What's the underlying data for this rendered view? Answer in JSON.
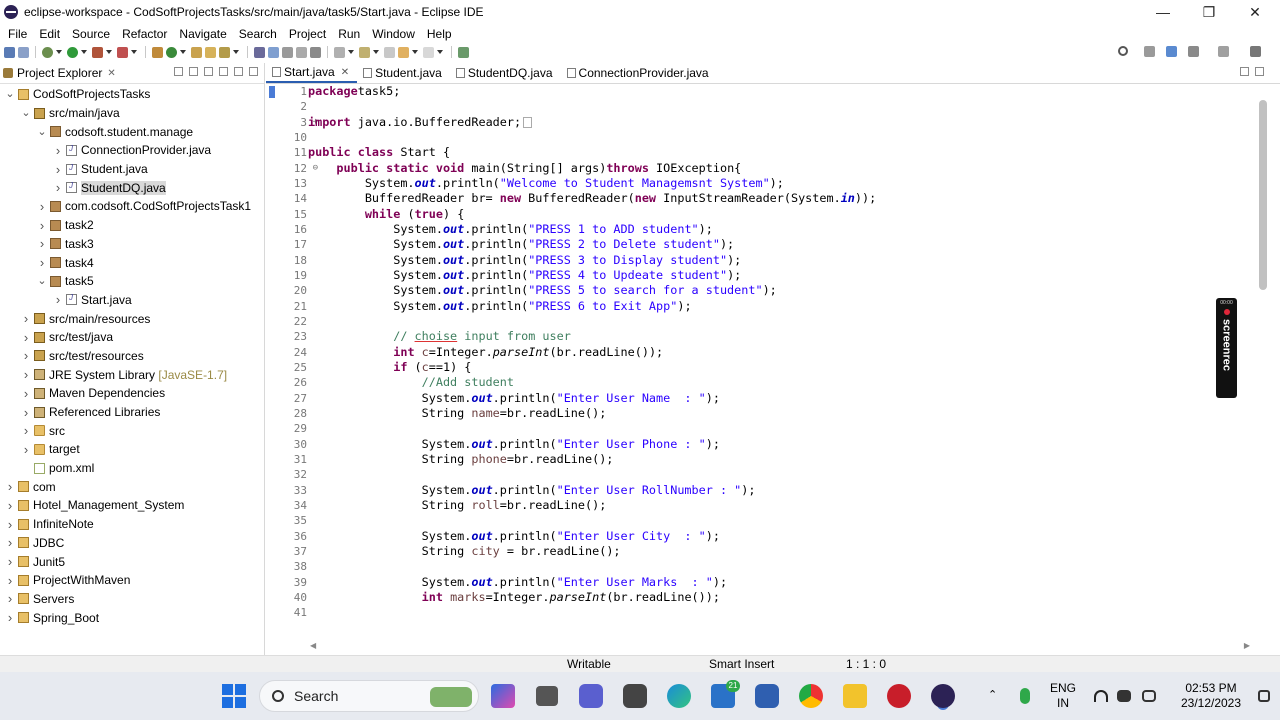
{
  "window": {
    "title": "eclipse-workspace - CodSoftProjectsTasks/src/main/java/task5/Start.java - Eclipse IDE",
    "minimize_icon": "minimize-icon",
    "restore_icon": "restore-icon",
    "close_icon": "close-icon"
  },
  "menu": [
    "File",
    "Edit",
    "Source",
    "Refactor",
    "Navigate",
    "Search",
    "Project",
    "Run",
    "Window",
    "Help"
  ],
  "left_pane": {
    "tab_label": "Project Explorer",
    "tree": [
      {
        "label": "CodSoftProjectsTasks",
        "depth": 0,
        "twisty": "v",
        "icon": "project"
      },
      {
        "label": "src/main/java",
        "depth": 1,
        "twisty": "v",
        "icon": "srcfolder"
      },
      {
        "label": "codsoft.student.manage",
        "depth": 2,
        "twisty": "v",
        "icon": "package"
      },
      {
        "label": "ConnectionProvider.java",
        "depth": 3,
        "twisty": ">",
        "icon": "java"
      },
      {
        "label": "Student.java",
        "depth": 3,
        "twisty": ">",
        "icon": "java"
      },
      {
        "label": "StudentDQ.java",
        "depth": 3,
        "twisty": ">",
        "icon": "java",
        "selected": true
      },
      {
        "label": "com.codsoft.CodSoftProjectsTask1",
        "depth": 2,
        "twisty": ">",
        "icon": "package"
      },
      {
        "label": "task2",
        "depth": 2,
        "twisty": ">",
        "icon": "package"
      },
      {
        "label": "task3",
        "depth": 2,
        "twisty": ">",
        "icon": "package"
      },
      {
        "label": "task4",
        "depth": 2,
        "twisty": ">",
        "icon": "package"
      },
      {
        "label": "task5",
        "depth": 2,
        "twisty": "v",
        "icon": "package"
      },
      {
        "label": "Start.java",
        "depth": 3,
        "twisty": ">",
        "icon": "java"
      },
      {
        "label": "src/main/resources",
        "depth": 1,
        "twisty": ">",
        "icon": "srcfolder"
      },
      {
        "label": "src/test/java",
        "depth": 1,
        "twisty": ">",
        "icon": "srcfolder"
      },
      {
        "label": "src/test/resources",
        "depth": 1,
        "twisty": ">",
        "icon": "srcfolder"
      },
      {
        "label": "JRE System Library",
        "suffix": "[JavaSE-1.7]",
        "depth": 1,
        "twisty": ">",
        "icon": "lib"
      },
      {
        "label": "Maven Dependencies",
        "depth": 1,
        "twisty": ">",
        "icon": "lib"
      },
      {
        "label": "Referenced Libraries",
        "depth": 1,
        "twisty": ">",
        "icon": "lib"
      },
      {
        "label": "src",
        "depth": 1,
        "twisty": ">",
        "icon": "folder"
      },
      {
        "label": "target",
        "depth": 1,
        "twisty": ">",
        "icon": "folder"
      },
      {
        "label": "pom.xml",
        "depth": 1,
        "twisty": "",
        "icon": "xml"
      },
      {
        "label": "com",
        "depth": 0,
        "twisty": ">",
        "icon": "project"
      },
      {
        "label": "Hotel_Management_System",
        "depth": 0,
        "twisty": ">",
        "icon": "project"
      },
      {
        "label": "InfiniteNote",
        "depth": 0,
        "twisty": ">",
        "icon": "project"
      },
      {
        "label": "JDBC",
        "depth": 0,
        "twisty": ">",
        "icon": "project"
      },
      {
        "label": "Junit5",
        "depth": 0,
        "twisty": ">",
        "icon": "project"
      },
      {
        "label": "ProjectWithMaven",
        "depth": 0,
        "twisty": ">",
        "icon": "project"
      },
      {
        "label": "Servers",
        "depth": 0,
        "twisty": ">",
        "icon": "project"
      },
      {
        "label": "Spring_Boot",
        "depth": 0,
        "twisty": ">",
        "icon": "project"
      }
    ]
  },
  "editor_tabs": [
    {
      "label": "Start.java",
      "active": true
    },
    {
      "label": "Student.java",
      "active": false
    },
    {
      "label": "StudentDQ.java",
      "active": false
    },
    {
      "label": "ConnectionProvider.java",
      "active": false
    }
  ],
  "editor": {
    "lines": [
      {
        "no": "1",
        "fold": "",
        "tokens": [
          [
            "kw",
            "package"
          ],
          [
            "",
            "task5;"
          ]
        ]
      },
      {
        "no": "2",
        "fold": "",
        "tokens": []
      },
      {
        "no": "3",
        "fold": "+",
        "tokens": [
          [
            "kw",
            "import"
          ],
          [
            "",
            " java.io.BufferedReader;"
          ],
          [
            "box",
            "□"
          ]
        ]
      },
      {
        "no": "10",
        "fold": "",
        "tokens": []
      },
      {
        "no": "11",
        "fold": "",
        "tokens": [
          [
            "kw",
            "public class"
          ],
          [
            "",
            " Start {"
          ]
        ]
      },
      {
        "no": "12",
        "fold": "-",
        "tokens": [
          [
            "",
            "    "
          ],
          [
            "kw",
            "public static void"
          ],
          [
            "",
            " main(String[] args)"
          ],
          [
            "kw",
            "throws"
          ],
          [
            "",
            " IOException{"
          ]
        ]
      },
      {
        "no": "13",
        "fold": "",
        "tokens": [
          [
            "",
            "        System."
          ],
          [
            "fld",
            "out"
          ],
          [
            "",
            ".println("
          ],
          [
            "str",
            "\"Welcome to Student Managemsnt System\""
          ],
          [
            "",
            ");"
          ]
        ]
      },
      {
        "no": "14",
        "fold": "",
        "tokens": [
          [
            "",
            "        BufferedReader br= "
          ],
          [
            "kw",
            "new"
          ],
          [
            "",
            " BufferedReader("
          ],
          [
            "kw",
            "new"
          ],
          [
            "",
            " InputStreamReader(System."
          ],
          [
            "fld",
            "in"
          ],
          [
            "",
            "));"
          ]
        ]
      },
      {
        "no": "15",
        "fold": "",
        "tokens": [
          [
            "",
            "        "
          ],
          [
            "kw",
            "while"
          ],
          [
            "",
            " ("
          ],
          [
            "kw",
            "true"
          ],
          [
            "",
            ") {"
          ]
        ]
      },
      {
        "no": "16",
        "fold": "",
        "tokens": [
          [
            "",
            "            System."
          ],
          [
            "fld",
            "out"
          ],
          [
            "",
            ".println("
          ],
          [
            "str",
            "\"PRESS 1 to ADD student\""
          ],
          [
            "",
            ");"
          ]
        ]
      },
      {
        "no": "17",
        "fold": "",
        "tokens": [
          [
            "",
            "            System."
          ],
          [
            "fld",
            "out"
          ],
          [
            "",
            ".println("
          ],
          [
            "str",
            "\"PRESS 2 to Delete student\""
          ],
          [
            "",
            ");"
          ]
        ]
      },
      {
        "no": "18",
        "fold": "",
        "tokens": [
          [
            "",
            "            System."
          ],
          [
            "fld",
            "out"
          ],
          [
            "",
            ".println("
          ],
          [
            "str",
            "\"PRESS 3 to Display student\""
          ],
          [
            "",
            ");"
          ]
        ]
      },
      {
        "no": "19",
        "fold": "",
        "tokens": [
          [
            "",
            "            System."
          ],
          [
            "fld",
            "out"
          ],
          [
            "",
            ".println("
          ],
          [
            "str",
            "\"PRESS 4 to Updeate student\""
          ],
          [
            "",
            ");"
          ]
        ]
      },
      {
        "no": "20",
        "fold": "",
        "tokens": [
          [
            "",
            "            System."
          ],
          [
            "fld",
            "out"
          ],
          [
            "",
            ".println("
          ],
          [
            "str",
            "\"PRESS 5 to search for a student\""
          ],
          [
            "",
            ");"
          ]
        ]
      },
      {
        "no": "21",
        "fold": "",
        "tokens": [
          [
            "",
            "            System."
          ],
          [
            "fld",
            "out"
          ],
          [
            "",
            ".println("
          ],
          [
            "str",
            "\"PRESS 6 to Exit App\""
          ],
          [
            "",
            ");"
          ]
        ]
      },
      {
        "no": "22",
        "fold": "",
        "tokens": []
      },
      {
        "no": "23",
        "fold": "",
        "tokens": [
          [
            "",
            "            "
          ],
          [
            "cm",
            "// "
          ],
          [
            "cmu",
            "choise"
          ],
          [
            "cm",
            " input from user"
          ]
        ]
      },
      {
        "no": "24",
        "fold": "",
        "tokens": [
          [
            "",
            "            "
          ],
          [
            "kw",
            "int"
          ],
          [
            "",
            " "
          ],
          [
            "var",
            "c"
          ],
          [
            "",
            "=Integer."
          ],
          [
            "stat",
            "parseInt"
          ],
          [
            "",
            "(br.readLine());"
          ]
        ]
      },
      {
        "no": "25",
        "fold": "",
        "tokens": [
          [
            "",
            "            "
          ],
          [
            "kw",
            "if"
          ],
          [
            "",
            " ("
          ],
          [
            "var",
            "c"
          ],
          [
            "",
            "==1) {"
          ]
        ]
      },
      {
        "no": "26",
        "fold": "",
        "tokens": [
          [
            "",
            "                "
          ],
          [
            "cm",
            "//Add student"
          ]
        ]
      },
      {
        "no": "27",
        "fold": "",
        "tokens": [
          [
            "",
            "                System."
          ],
          [
            "fld",
            "out"
          ],
          [
            "",
            ".println("
          ],
          [
            "str",
            "\"Enter User Name  : \""
          ],
          [
            "",
            ");"
          ]
        ]
      },
      {
        "no": "28",
        "fold": "",
        "tokens": [
          [
            "",
            "                String "
          ],
          [
            "var",
            "name"
          ],
          [
            "",
            "=br.readLine();"
          ]
        ]
      },
      {
        "no": "29",
        "fold": "",
        "tokens": []
      },
      {
        "no": "30",
        "fold": "",
        "tokens": [
          [
            "",
            "                System."
          ],
          [
            "fld",
            "out"
          ],
          [
            "",
            ".println("
          ],
          [
            "str",
            "\"Enter User Phone : \""
          ],
          [
            "",
            ");"
          ]
        ]
      },
      {
        "no": "31",
        "fold": "",
        "tokens": [
          [
            "",
            "                String "
          ],
          [
            "var",
            "phone"
          ],
          [
            "",
            "=br.readLine();"
          ]
        ]
      },
      {
        "no": "32",
        "fold": "",
        "tokens": []
      },
      {
        "no": "33",
        "fold": "",
        "tokens": [
          [
            "",
            "                System."
          ],
          [
            "fld",
            "out"
          ],
          [
            "",
            ".println("
          ],
          [
            "str",
            "\"Enter User RollNumber : \""
          ],
          [
            "",
            ");"
          ]
        ]
      },
      {
        "no": "34",
        "fold": "",
        "tokens": [
          [
            "",
            "                String "
          ],
          [
            "var",
            "roll"
          ],
          [
            "",
            "=br.readLine();"
          ]
        ]
      },
      {
        "no": "35",
        "fold": "",
        "tokens": []
      },
      {
        "no": "36",
        "fold": "",
        "tokens": [
          [
            "",
            "                System."
          ],
          [
            "fld",
            "out"
          ],
          [
            "",
            ".println("
          ],
          [
            "str",
            "\"Enter User City  : \""
          ],
          [
            "",
            ");"
          ]
        ]
      },
      {
        "no": "37",
        "fold": "",
        "tokens": [
          [
            "",
            "                String "
          ],
          [
            "var",
            "city"
          ],
          [
            "",
            " = br.readLine();"
          ]
        ]
      },
      {
        "no": "38",
        "fold": "",
        "tokens": []
      },
      {
        "no": "39",
        "fold": "",
        "tokens": [
          [
            "",
            "                System."
          ],
          [
            "fld",
            "out"
          ],
          [
            "",
            ".println("
          ],
          [
            "str",
            "\"Enter User Marks  : \""
          ],
          [
            "",
            ");"
          ]
        ]
      },
      {
        "no": "40",
        "fold": "",
        "tokens": [
          [
            "",
            "                "
          ],
          [
            "kw",
            "int"
          ],
          [
            "",
            " "
          ],
          [
            "var",
            "marks"
          ],
          [
            "",
            "=Integer."
          ],
          [
            "stat",
            "parseInt"
          ],
          [
            "",
            "(br.readLine());"
          ]
        ]
      },
      {
        "no": "41",
        "fold": "",
        "tokens": []
      }
    ]
  },
  "screenrec": {
    "time": "00:00",
    "brand": "screenrec"
  },
  "status": {
    "writable": "Writable",
    "insert_mode": "Smart Insert",
    "position": "1 : 1 : 0"
  },
  "taskbar": {
    "search_label": "Search",
    "badge_count": "21",
    "lang_line1": "ENG",
    "lang_line2": "IN",
    "time": "02:53 PM",
    "date": "23/12/2023"
  }
}
